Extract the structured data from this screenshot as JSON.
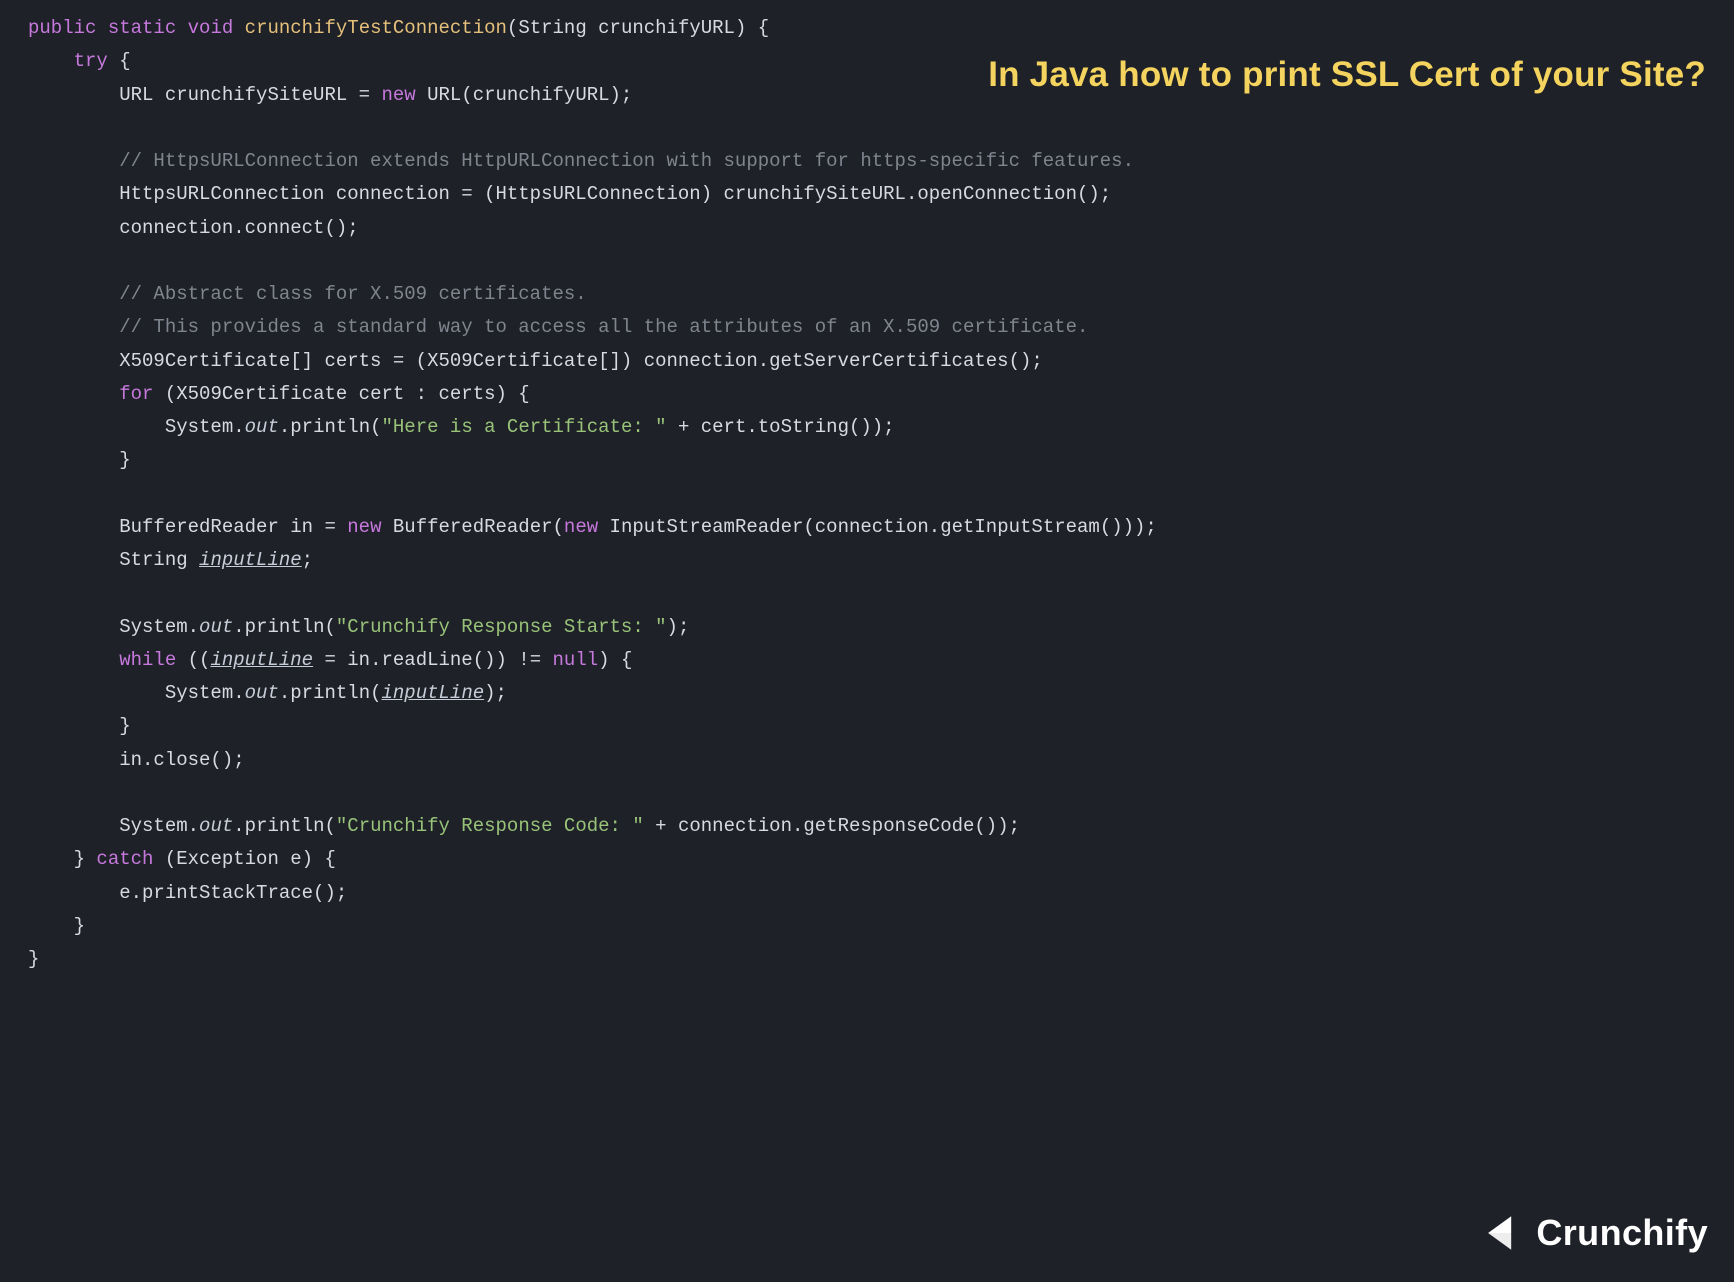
{
  "title": "In Java how to print SSL Cert of your Site?",
  "logo_text": "Crunchify",
  "code": {
    "line01_kw1": "public",
    "line01_kw2": "static",
    "line01_kw3": "void",
    "line01_fn": "crunchifyTestConnection",
    "line01_rest": "(String crunchifyURL) {",
    "line02_kw": "try",
    "line02_rest": " {",
    "line03_a": "URL crunchifySiteURL = ",
    "line03_kw": "new",
    "line03_b": " URL(crunchifyURL);",
    "line05_cmt": "// HttpsURLConnection extends HttpURLConnection with support for https-specific features.",
    "line06": "HttpsURLConnection connection = (HttpsURLConnection) crunchifySiteURL.openConnection();",
    "line07": "connection.connect();",
    "line09_cmt": "// Abstract class for X.509 certificates.",
    "line10_cmt": "// This provides a standard way to access all the attributes of an X.509 certificate.",
    "line11": "X509Certificate[] certs = (X509Certificate[]) connection.getServerCertificates();",
    "line12_kw": "for",
    "line12_rest": " (X509Certificate cert : certs) {",
    "line13_a": "System.",
    "line13_out": "out",
    "line13_b": ".println(",
    "line13_str": "\"Here is a Certificate: \"",
    "line13_c": " + cert.toString());",
    "line14": "}",
    "line16_a": "BufferedReader in = ",
    "line16_kw1": "new",
    "line16_b": " BufferedReader(",
    "line16_kw2": "new",
    "line16_c": " InputStreamReader(connection.getInputStream()));",
    "line17_a": "String ",
    "line17_it": "inputLine",
    "line17_b": ";",
    "line19_a": "System.",
    "line19_out": "out",
    "line19_b": ".println(",
    "line19_str": "\"Crunchify Response Starts: \"",
    "line19_c": ");",
    "line20_kw1": "while",
    "line20_a": " ((",
    "line20_it": "inputLine",
    "line20_b": " = in.readLine()) != ",
    "line20_kw2": "null",
    "line20_c": ") {",
    "line21_a": "System.",
    "line21_out": "out",
    "line21_b": ".println(",
    "line21_it": "inputLine",
    "line21_c": ");",
    "line22": "}",
    "line23": "in.close();",
    "line25_a": "System.",
    "line25_out": "out",
    "line25_b": ".println(",
    "line25_str": "\"Crunchify Response Code: \"",
    "line25_c": " + connection.getResponseCode());",
    "line26_a": "} ",
    "line26_kw": "catch",
    "line26_b": " (Exception e) {",
    "line27": "e.printStackTrace();",
    "line28": "}",
    "line29": "}"
  }
}
